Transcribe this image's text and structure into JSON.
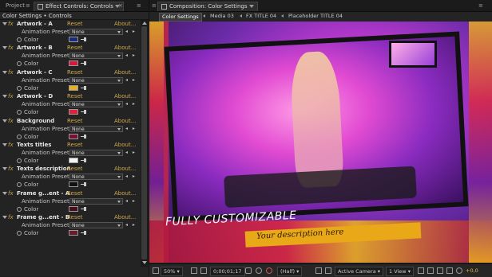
{
  "left_panel": {
    "tabs": [
      {
        "label": "Project"
      },
      {
        "label": "Effect Controls: Controls"
      }
    ],
    "menu_glyph": "≡",
    "subtitle": "Color Settings • Controls",
    "effect_marker": "fx",
    "effects": [
      {
        "name": "Artwork - A",
        "reset": "Reset",
        "about": "About...",
        "preset_label": "Animation Presets:",
        "preset_value": "None",
        "color_label": "Color",
        "color": "#1b2a7a"
      },
      {
        "name": "Artwork - B",
        "reset": "Reset",
        "about": "About...",
        "preset_label": "Animation Presets:",
        "preset_value": "None",
        "color_label": "Color",
        "color": "#d8183a"
      },
      {
        "name": "Artwork - C",
        "reset": "Reset",
        "about": "About...",
        "preset_label": "Animation Presets:",
        "preset_value": "None",
        "color_label": "Color",
        "color": "#e8b020"
      },
      {
        "name": "Artwork - D",
        "reset": "Reset",
        "about": "About...",
        "preset_label": "Animation Presets:",
        "preset_value": "None",
        "color_label": "Color",
        "color": "#e0203c"
      },
      {
        "name": "Background",
        "reset": "Reset",
        "about": "About...",
        "preset_label": "Animation Presets:",
        "preset_value": "None",
        "color_label": "Color",
        "color": "#7a1030"
      },
      {
        "name": "Texts titles",
        "reset": "Reset",
        "about": "About...",
        "preset_label": "Animation Presets:",
        "preset_value": "None",
        "color_label": "Color",
        "color": "#f4f4f4"
      },
      {
        "name": "Texts description",
        "reset": "Reset",
        "about": "About...",
        "preset_label": "Animation Presets:",
        "preset_value": "None",
        "color_label": "Color",
        "color": "#111111"
      },
      {
        "name": "Frame g...ent - A",
        "reset": "Reset",
        "about": "About...",
        "preset_label": "Animation Presets:",
        "preset_value": "None",
        "color_label": "Color",
        "color": "#4a0e1c"
      },
      {
        "name": "Frame g...ent - B",
        "reset": "Reset",
        "about": "About...",
        "preset_label": "Animation Presets:",
        "preset_value": "None",
        "color_label": "Color",
        "color": "#6a1a2a"
      }
    ]
  },
  "right_panel": {
    "tab_label": "Composition: Color Settings",
    "breadcrumbs": [
      {
        "label": "Color Settings"
      },
      {
        "label": "Media 03"
      },
      {
        "label": "FX TITLE 04"
      },
      {
        "label": "Placeholder TITLE 04"
      }
    ],
    "viewer": {
      "headline": "FULLY CUSTOMIZABLE",
      "subline": "Your description here"
    },
    "bottom_bar": {
      "zoom": "50%",
      "timecode": "0;00;01;17",
      "resolution": "(Half)",
      "camera": "Active Camera",
      "views": "1 View",
      "exposure": "+0,0"
    }
  },
  "colors": {
    "accent_link": "#d0a84c",
    "panel_bg": "#232323",
    "stripe_yellow": "#f2b51c",
    "stripe_red": "#e0283c",
    "stripe_purple": "#7a1f9a"
  }
}
